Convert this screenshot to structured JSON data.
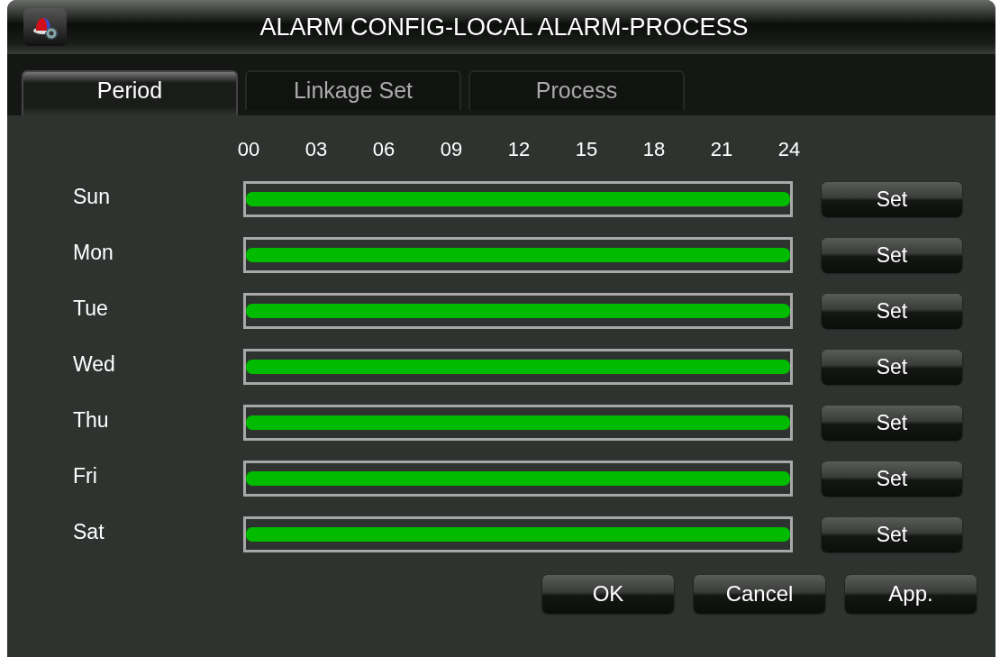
{
  "window": {
    "title": "ALARM CONFIG-LOCAL ALARM-PROCESS"
  },
  "tabs": [
    {
      "label": "Period",
      "selected": true
    },
    {
      "label": "Linkage Set",
      "selected": false
    },
    {
      "label": "Process",
      "selected": false
    }
  ],
  "hours": [
    "00",
    "03",
    "06",
    "09",
    "12",
    "15",
    "18",
    "21",
    "24"
  ],
  "days": [
    {
      "name": "Sun",
      "level": 1,
      "button": "Set"
    },
    {
      "name": "Mon",
      "level": 1,
      "button": "Set"
    },
    {
      "name": "Tue",
      "level": 1,
      "button": "Set"
    },
    {
      "name": "Wed",
      "level": 1,
      "button": "Set"
    },
    {
      "name": "Thu",
      "level": 1,
      "button": "Set"
    },
    {
      "name": "Fri",
      "level": 1,
      "button": "Set"
    },
    {
      "name": "Sat",
      "level": 1,
      "button": "Set"
    }
  ],
  "buttons": [
    "OK",
    "Cancel",
    "App."
  ]
}
